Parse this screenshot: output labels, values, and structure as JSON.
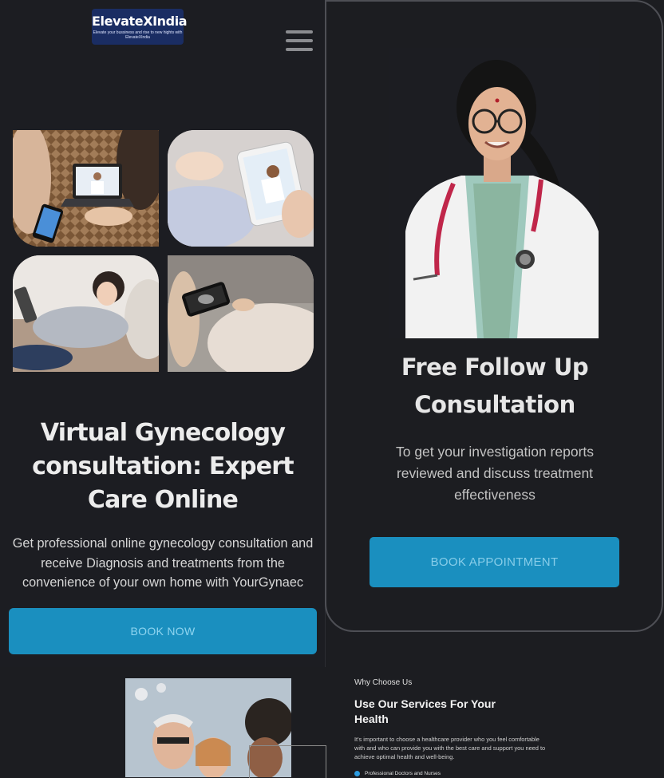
{
  "brand": {
    "name": "ElevateXIndia",
    "tagline": "Elevate your bussiness and rise to new hights with ElevateXIndia"
  },
  "hero": {
    "title": "Virtual Gynecology consultation: Expert Care Online",
    "description": "Get professional online gynecology consultation and receive Diagnosis and treatments from the convenience of your own home with YourGynaec",
    "cta": "BOOK NOW"
  },
  "followup": {
    "title": "Free Follow Up Consultation",
    "description": "To get your investigation reports reviewed and discuss treatment effectiveness",
    "cta": "BOOK APPOINTMENT"
  },
  "why_choose": {
    "eyebrow": "Why Choose Us",
    "title": "Use Our Services For Your Health",
    "description": "It's important to choose a healthcare provider who you feel comfortable with and who can provide you with the best care and support you need to achieve optimal health and well-being.",
    "first_item": "Professional Doctors and Nurses"
  },
  "colors": {
    "background": "#1c1d22",
    "accent": "#1a8fbf",
    "logo_bg": "#1a2d63"
  },
  "icons": {
    "menu": "hamburger-menu-icon"
  }
}
